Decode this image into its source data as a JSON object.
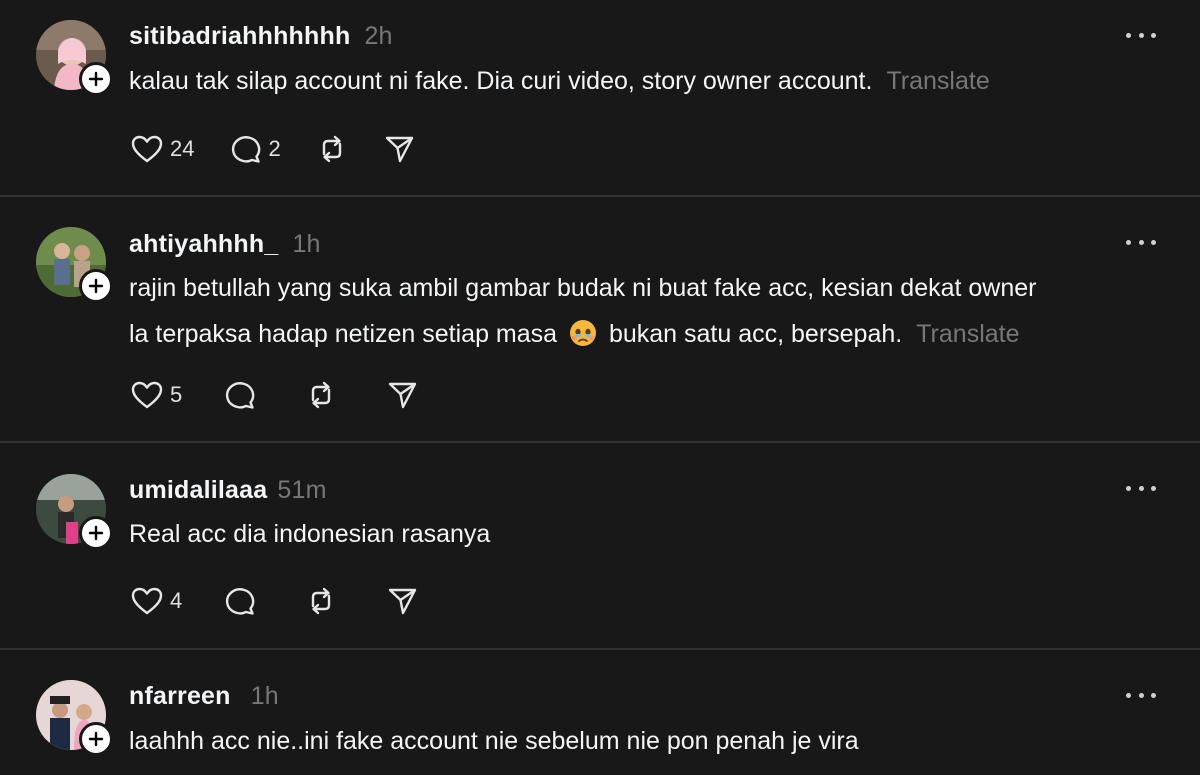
{
  "posts": [
    {
      "username": "sitibadriahhhhhhh",
      "time": "2h",
      "text": "kalau tak silap account ni fake. Dia curi video, story owner account.",
      "translate": "Translate",
      "likes": "24",
      "replies": "2"
    },
    {
      "username": "ahtiyahhhh_",
      "time": "1h",
      "text_line1": "rajin betullah yang suka ambil gambar budak ni buat fake acc, kesian dekat owner",
      "text_line2_a": "la terpaksa hadap netizen setiap masa",
      "text_line2_b": "bukan satu acc, bersepah.",
      "emoji": "holding-back-tears-emoji",
      "translate": "Translate",
      "likes": "5",
      "replies": ""
    },
    {
      "username": "umidalilaaa",
      "time": "51m",
      "text": "Real acc dia indonesian rasanya",
      "likes": "4",
      "replies": ""
    },
    {
      "username": "nfarreen",
      "time": "1h",
      "text": "laahhh acc nie..ini fake account nie sebelum nie pon penah je vira"
    }
  ],
  "icons": {
    "like": "heart-icon",
    "reply": "comment-icon",
    "repost": "repost-icon",
    "share": "send-icon",
    "more": "more-options-icon",
    "follow": "plus-icon"
  },
  "colors": {
    "background": "#181818",
    "text": "#f3f5f7",
    "muted": "#777777",
    "divider": "#323232"
  }
}
